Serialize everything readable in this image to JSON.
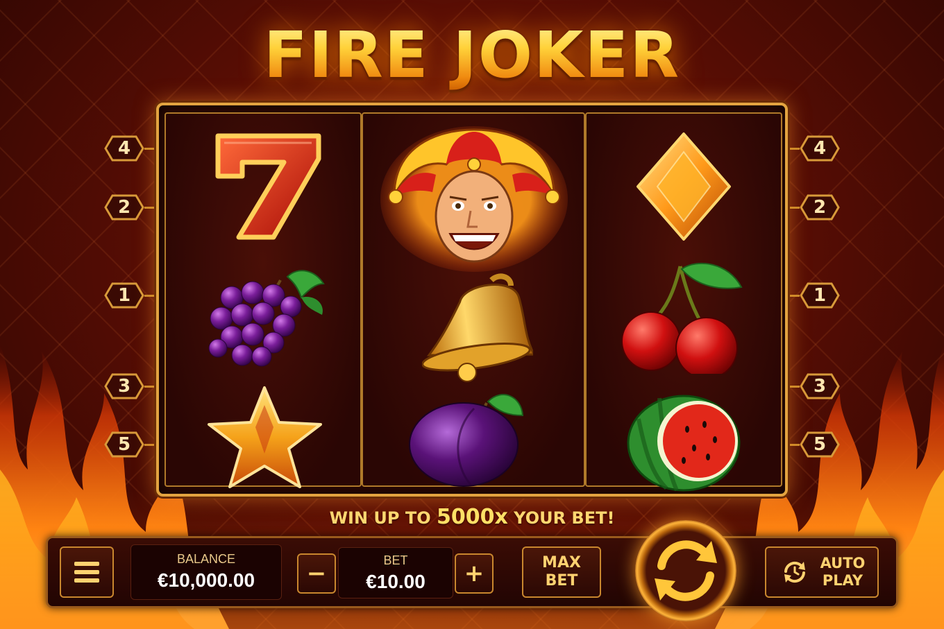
{
  "title": "FIRE JOKER",
  "paylines": {
    "left": [
      "4",
      "2",
      "1",
      "3",
      "5"
    ],
    "right": [
      "4",
      "2",
      "1",
      "3",
      "5"
    ]
  },
  "reels": [
    [
      "seven-symbol",
      "grapes-symbol",
      "star-symbol"
    ],
    [
      "joker-symbol",
      "bell-symbol",
      "plum-symbol"
    ],
    [
      "diamond-symbol",
      "cherries-symbol",
      "watermelon-symbol"
    ]
  ],
  "promo": {
    "prefix": "WIN UP TO ",
    "highlight": "5000x",
    "suffix": " YOUR BET!"
  },
  "controls": {
    "menu_icon": "hamburger-menu-icon",
    "balance_label": "BALANCE",
    "balance_value": "€10,000.00",
    "bet_label": "BET",
    "bet_value": "€10.00",
    "minus_label": "−",
    "plus_label": "+",
    "max_bet_line1": "MAX",
    "max_bet_line2": "BET",
    "spin_icon": "spin-arrows-icon",
    "auto_play_line1": "AUTO",
    "auto_play_line2": "PLAY"
  },
  "colors": {
    "accent_gold": "#ffd270",
    "frame_gold": "#e3a440",
    "background_red": "#5a0e04"
  }
}
